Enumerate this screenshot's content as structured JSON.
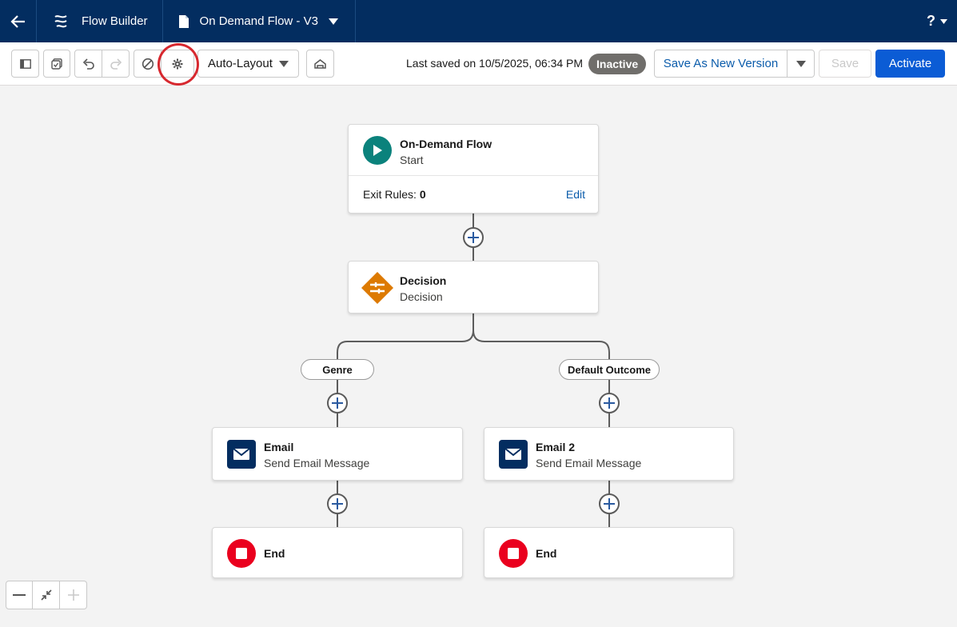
{
  "header": {
    "app_name": "Flow Builder",
    "flow_name": "On Demand Flow - V3",
    "help_label": "?"
  },
  "toolbar": {
    "layout_select": "Auto-Layout",
    "last_saved": "Last saved on 10/5/2025, 06:34 PM",
    "status_badge": "Inactive",
    "save_as_new_version": "Save As New Version",
    "save": "Save",
    "activate": "Activate"
  },
  "canvas": {
    "start": {
      "title": "On-Demand Flow",
      "subtitle": "Start",
      "exit_rules_label": "Exit Rules:",
      "exit_rules_count": "0",
      "edit_label": "Edit"
    },
    "decision": {
      "title": "Decision",
      "subtitle": "Decision"
    },
    "outcomes": [
      {
        "label": "Genre"
      },
      {
        "label": "Default Outcome"
      }
    ],
    "actions": [
      {
        "title": "Email",
        "subtitle": "Send Email Message"
      },
      {
        "title": "Email 2",
        "subtitle": "Send Email Message"
      }
    ],
    "ends": [
      {
        "title": "End"
      },
      {
        "title": "End"
      }
    ]
  },
  "colors": {
    "header_bg": "#032d60",
    "brand_blue": "#0b5cd5",
    "start_icon": "#0b827c",
    "decision_icon": "#dd7a01",
    "email_icon": "#032d60",
    "end_icon": "#ea001e",
    "inactive_badge": "#706e6b",
    "highlight": "#d7282f"
  }
}
